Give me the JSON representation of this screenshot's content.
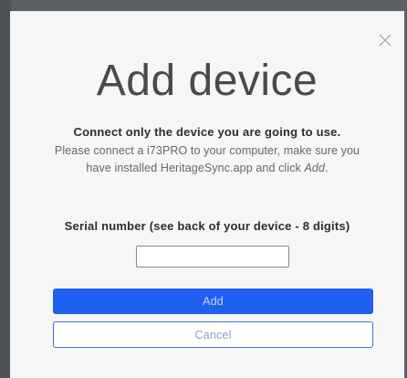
{
  "modal": {
    "title": "Add device",
    "lead": "Connect only the device you are going to use.",
    "instructions_main": "Please connect a i73PRO to your computer, make sure you have installed HeritageSync.app and click",
    "instructions_emph": "Add",
    "instructions_end": ".",
    "serial_label": "Serial number (see back of your device - 8 digits)",
    "serial_value": "",
    "add_label": "Add",
    "cancel_label": "Cancel",
    "close_icon": "close-icon"
  },
  "colors": {
    "primary": "#1f5ff2",
    "backdrop": "#5b5e63",
    "modal_bg": "#f6f6f6"
  }
}
